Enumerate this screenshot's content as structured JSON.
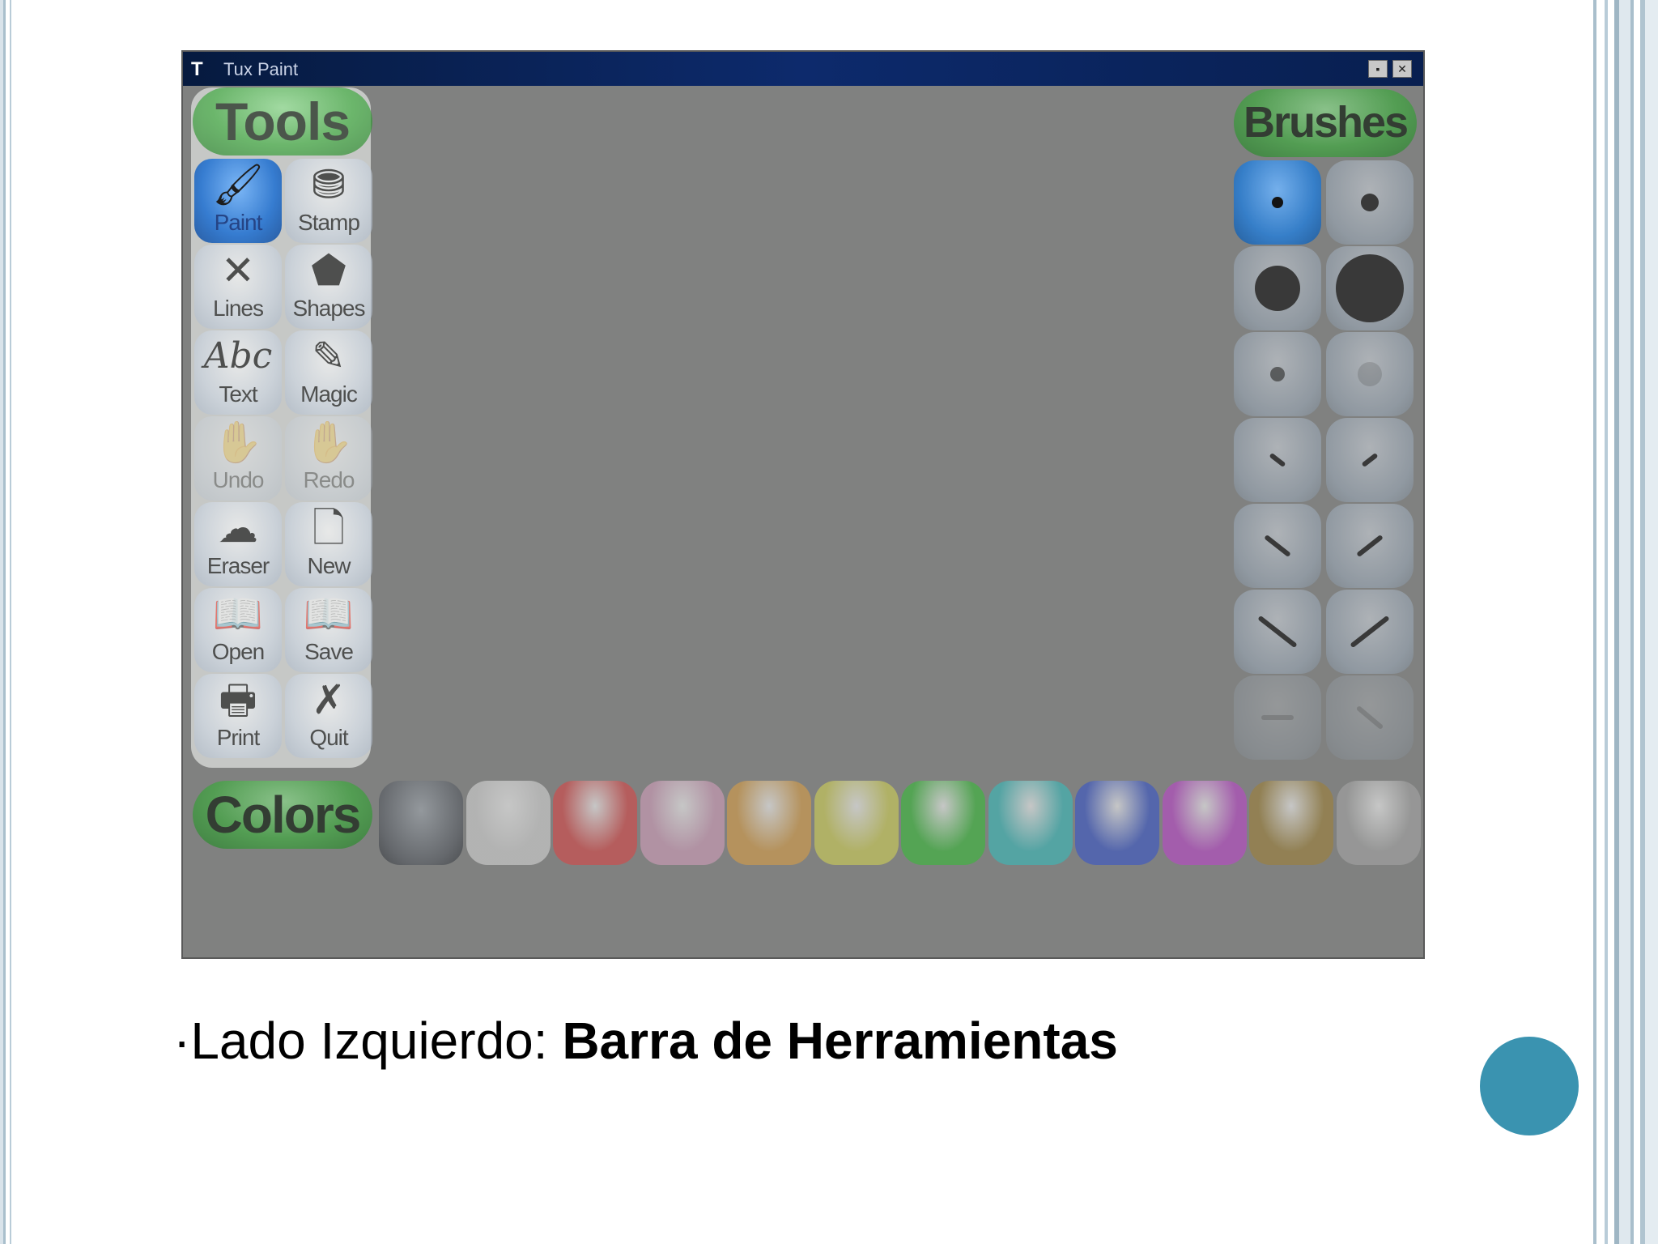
{
  "window": {
    "title": "Tux Paint",
    "app_icon": "tux-icon",
    "controls": [
      {
        "label": "▪",
        "icon": "minimize-icon"
      },
      {
        "label": "✕",
        "icon": "close-icon"
      }
    ]
  },
  "tools_panel": {
    "title": "Tools",
    "items": [
      {
        "label": "Paint",
        "icon": "paintbrush-icon",
        "active": true
      },
      {
        "label": "Stamp",
        "icon": "stamp-icon"
      },
      {
        "label": "Lines",
        "icon": "lines-icon"
      },
      {
        "label": "Shapes",
        "icon": "pentagon-icon"
      },
      {
        "label": "Text",
        "icon": "text-abc-icon"
      },
      {
        "label": "Magic",
        "icon": "magic-wand-icon"
      },
      {
        "label": "Undo",
        "icon": "undo-icon",
        "disabled": true
      },
      {
        "label": "Redo",
        "icon": "redo-icon",
        "disabled": true
      },
      {
        "label": "Eraser",
        "icon": "eraser-icon"
      },
      {
        "label": "New",
        "icon": "new-page-icon"
      },
      {
        "label": "Open",
        "icon": "open-book-icon"
      },
      {
        "label": "Save",
        "icon": "save-book-icon"
      },
      {
        "label": "Print",
        "icon": "printer-icon"
      },
      {
        "label": "Quit",
        "icon": "quit-x-icon"
      }
    ],
    "glyphs": [
      "🖌",
      "⛃",
      "✕",
      "⬟",
      "Abc",
      "✎",
      "✋",
      "✋",
      "☁",
      "🗋",
      "📖",
      "📖",
      "🖶",
      "✗"
    ]
  },
  "brushes_panel": {
    "title": "Brushes",
    "items": [
      {
        "name": "small-dot-brush",
        "active": true
      },
      {
        "name": "medium-dot-brush"
      },
      {
        "name": "large-dot-brush"
      },
      {
        "name": "xlarge-dot-brush"
      },
      {
        "name": "fuzzy-small-brush"
      },
      {
        "name": "fuzzy-large-brush"
      },
      {
        "name": "small-backslash-brush"
      },
      {
        "name": "small-slash-brush"
      },
      {
        "name": "medium-backslash-brush"
      },
      {
        "name": "medium-slash-brush"
      },
      {
        "name": "large-backslash-brush"
      },
      {
        "name": "large-slash-brush"
      },
      {
        "name": "sparkle-brush",
        "disabled": true
      },
      {
        "name": "cross-brush",
        "disabled": true
      }
    ]
  },
  "colors_panel": {
    "title": "Colors",
    "swatches": [
      {
        "name": "tux-color-picker",
        "color": "#4a4e52"
      },
      {
        "name": "white",
        "color": "#dcdcdc"
      },
      {
        "name": "red",
        "color": "#e04040"
      },
      {
        "name": "pink",
        "color": "#d9a0c0"
      },
      {
        "name": "orange",
        "color": "#e0a040"
      },
      {
        "name": "yellow",
        "color": "#d8d850"
      },
      {
        "name": "green",
        "color": "#30c030"
      },
      {
        "name": "cyan",
        "color": "#30c0c0"
      },
      {
        "name": "blue",
        "color": "#3050d0"
      },
      {
        "name": "purple",
        "color": "#c040d0"
      },
      {
        "name": "brown",
        "color": "#a08030"
      },
      {
        "name": "grey",
        "color": "#a8a8a8"
      }
    ]
  },
  "caption": {
    "prefix": "·Lado Izquierdo: ",
    "emphasis": "Barra de Herramientas"
  },
  "slide_colors": {
    "accent_dot": "#3a93b0",
    "border": "#a9bfcc"
  }
}
